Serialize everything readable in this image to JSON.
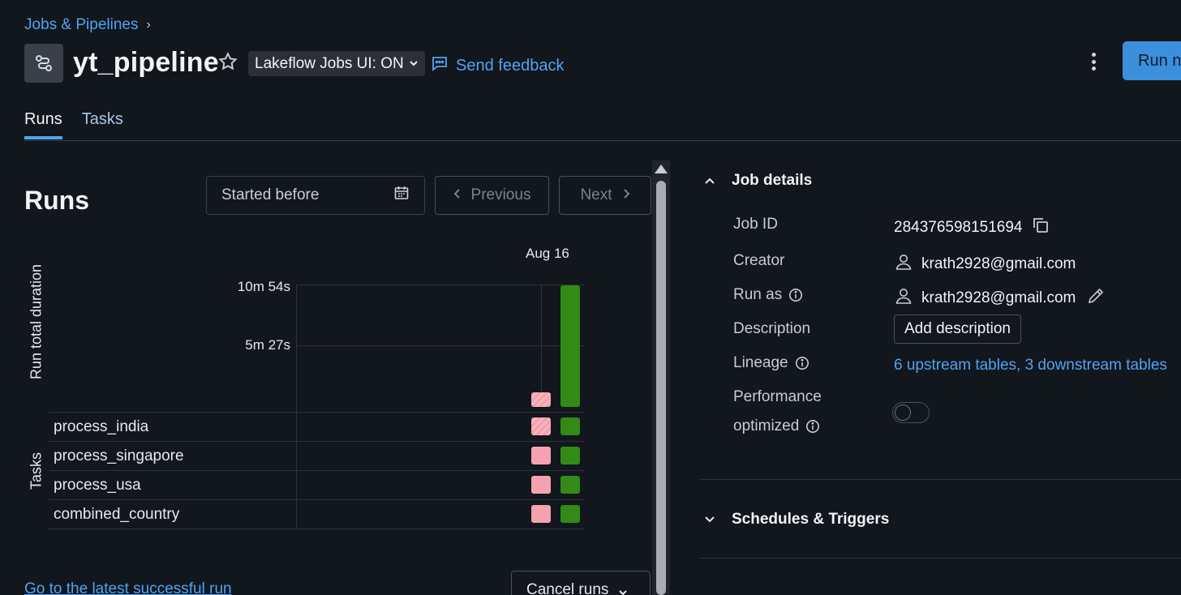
{
  "breadcrumb": {
    "parent": "Jobs & Pipelines",
    "sep": "›"
  },
  "header": {
    "title": "yt_pipeline",
    "lakeflow_toggle": "Lakeflow Jobs UI: ON",
    "feedback": "Send feedback",
    "run_now": "Run now"
  },
  "tabs": [
    {
      "label": "Runs",
      "active": true
    },
    {
      "label": "Tasks",
      "active": false
    }
  ],
  "runs": {
    "title": "Runs",
    "filter_placeholder": "Started before",
    "previous": "Previous",
    "next": "Next",
    "date_label": "Aug 16",
    "y_axis_label": "Run total duration",
    "y_ticks": [
      "10m 54s",
      "5m 27s"
    ],
    "tasks_label": "Tasks",
    "tasks": [
      "process_india",
      "process_singapore",
      "process_usa",
      "combined_country"
    ],
    "runs_summary": [
      {
        "status": "failed",
        "duration_label": "short"
      },
      {
        "status": "succeeded",
        "duration": "10m 54s"
      }
    ],
    "latest_link": "Go to the latest successful run",
    "cancel_runs": "Cancel runs",
    "colors": {
      "failed": "#f4a2b0",
      "succeeded": "#338a17"
    }
  },
  "details": {
    "section_title": "Job details",
    "job_id_label": "Job ID",
    "job_id": "284376598151694",
    "creator_label": "Creator",
    "creator": "krath2928@gmail.com",
    "run_as_label": "Run as",
    "run_as": "krath2928@gmail.com",
    "description_label": "Description",
    "add_description": "Add description",
    "lineage_label": "Lineage",
    "lineage": "6 upstream tables, 3 downstream tables",
    "performance_label_1": "Performance",
    "performance_label_2": "optimized",
    "performance_optimized": false
  },
  "schedules": {
    "section_title": "Schedules & Triggers"
  }
}
